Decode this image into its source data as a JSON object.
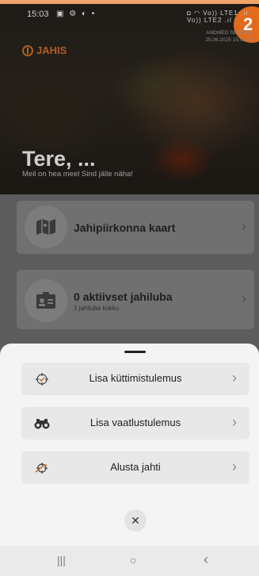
{
  "status_bar": {
    "time": "15:03",
    "left_icons": "▣ ⚙ ◐ •",
    "right_icons": "◘ ◠ Vo)) LTE1 .ıl Vo)) LTE2 .ıl"
  },
  "sync": {
    "label": "ANDMED SEISUGA",
    "timestamp": "25.06.2025 15:03:26"
  },
  "corner_badge": "2",
  "logo": {
    "text": "JAHIS"
  },
  "greeting": {
    "title": "Tere, ...",
    "subtitle": "Meil on hea meel Sind jälle näha!"
  },
  "cards": [
    {
      "title": "Jahipiirkonna kaart",
      "subtitle": "",
      "icon": "map-icon"
    },
    {
      "title": "0 aktiivset jahiluba",
      "subtitle": "1 jahiluba kokku",
      "icon": "license-card-icon"
    }
  ],
  "actions": [
    {
      "label": "Lisa küttimistulemus",
      "icon": "crosshair-target-icon"
    },
    {
      "label": "Lisa vaatlustulemus",
      "icon": "binoculars-icon"
    },
    {
      "label": "Alusta jahti",
      "icon": "crosshair-rifle-icon"
    }
  ],
  "close_label": "✕",
  "nav": {
    "recents": "|||",
    "home": "○",
    "back": "‹"
  },
  "colors": {
    "accent": "#e26a1c",
    "sheet_bg": "#f4f4f4",
    "action_bg": "#e8e8e8",
    "overlay_content": "#5d5d5d"
  }
}
